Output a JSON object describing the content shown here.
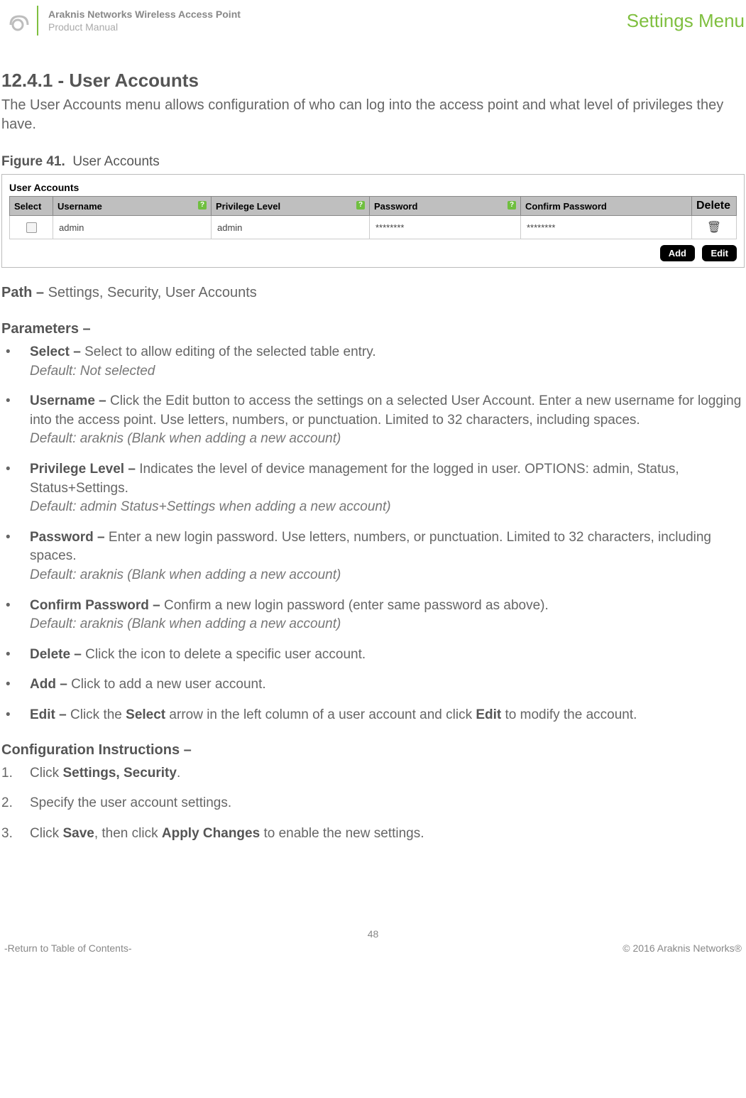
{
  "header": {
    "title1": "Araknis Networks Wireless Access Point",
    "title2": "Product Manual",
    "menu": "Settings Menu"
  },
  "section": {
    "number": "12.4.1 - User Accounts",
    "intro": "The User Accounts menu allows configuration of who can log into the access point and what level of privileges they have."
  },
  "figure": {
    "label_prefix": "Figure 41.",
    "label_text": "User Accounts",
    "panel_title": "User Accounts",
    "columns": {
      "select": "Select",
      "username": "Username",
      "privilege": "Privilege Level",
      "password": "Password",
      "confirm": "Confirm Password",
      "delete": "Delete"
    },
    "row": {
      "username": "admin",
      "privilege": "admin",
      "password": "********",
      "confirm": "********"
    },
    "buttons": {
      "add": "Add",
      "edit": "Edit"
    }
  },
  "path": {
    "label": "Path –",
    "value": "Settings, Security, User Accounts"
  },
  "params_head": "Parameters –",
  "params": {
    "select": {
      "name": "Select – ",
      "text": "Select to allow editing of the selected table entry.",
      "default": "Default: Not selected"
    },
    "username": {
      "name": "Username – ",
      "text": "Click the Edit button to access the settings on a selected User Account. Enter a new username for logging into the access point. Use letters, numbers, or punctuation. Limited to 32 characters, including spaces.",
      "default": "Default: araknis (Blank when adding a new account)"
    },
    "privilege": {
      "name": "Privilege Level – ",
      "text": "Indicates the level of device management for the logged in user. OPTIONS: admin, Status, Status+Settings.",
      "default": "Default: admin Status+Settings when adding a new account)"
    },
    "password": {
      "name": "Password – ",
      "text": "Enter a new login password. Use letters, numbers, or punctuation. Limited to 32 characters, including spaces.",
      "default": "Default: araknis (Blank when adding a new account)"
    },
    "confirm": {
      "name": "Confirm Password – ",
      "text": "Confirm a new login password (enter same password as above).",
      "default": "Default: araknis (Blank when adding a new account)"
    },
    "delete": {
      "name": "Delete – ",
      "text": "Click the icon to delete a specific user account."
    },
    "add": {
      "name": "Add – ",
      "text": "Click to add a new user account."
    },
    "edit": {
      "name": "Edit – ",
      "pre": "Click the ",
      "bold1": "Select",
      "mid": " arrow in the left column of a user account and click ",
      "bold2": "Edit",
      "post": " to modify the account."
    }
  },
  "instructions_head": "Configuration Instructions –",
  "instructions": {
    "s1a": "Click ",
    "s1b": "Settings, Security",
    "s1c": ".",
    "s2": "Specify the user account settings.",
    "s3a": "Click ",
    "s3b": "Save",
    "s3c": ", then click ",
    "s3d": "Apply Changes",
    "s3e": " to enable the new settings."
  },
  "footer": {
    "page": "48",
    "toc": "-Return to Table of Contents-",
    "copyright": "© 2016 Araknis Networks®"
  },
  "glyphs": {
    "help": "?",
    "trash": "🗑"
  }
}
